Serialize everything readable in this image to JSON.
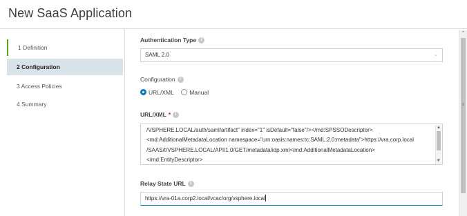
{
  "header": {
    "title": "New SaaS Application"
  },
  "sidebar": {
    "steps": [
      {
        "label": "1 Definition"
      },
      {
        "label": "2 Configuration"
      },
      {
        "label": "3 Access Policies"
      },
      {
        "label": "4 Summary"
      }
    ]
  },
  "form": {
    "auth_type": {
      "label": "Authentication Type",
      "value": "SAML 2.0"
    },
    "configuration": {
      "label": "Configuration",
      "options": [
        {
          "label": "URL/XML",
          "selected": true
        },
        {
          "label": "Manual",
          "selected": false
        }
      ]
    },
    "url_xml": {
      "label": "URL/XML",
      "required_mark": "*",
      "lines": [
        "/VSPHERE.LOCAL/auth/saml/artifact\" index=\"1\" isDefault=\"false\"/></md:SPSSODescriptor>",
        "<md:AdditionalMetadataLocation namespace=\"urn:oasis:names:tc:SAML:2.0:metadata\">https://vra.corp.local",
        "/SAAS/t/VSPHERE.LOCAL/API/1.0/GET/metadata/idp.xml</md:AdditionalMetadataLocation>",
        "</md:EntityDescriptor>"
      ]
    },
    "relay_state": {
      "label": "Relay State URL",
      "value": "https://vra-01a.corp2.local/vcac/org/vsphere.local"
    }
  },
  "icons": {
    "info": "info-icon",
    "chevron": "chevron-down-icon"
  },
  "colors": {
    "accent": "#0079b8",
    "completed": "#5aa220",
    "active_step_bg": "#d8e3e9",
    "required": "#c92100"
  }
}
